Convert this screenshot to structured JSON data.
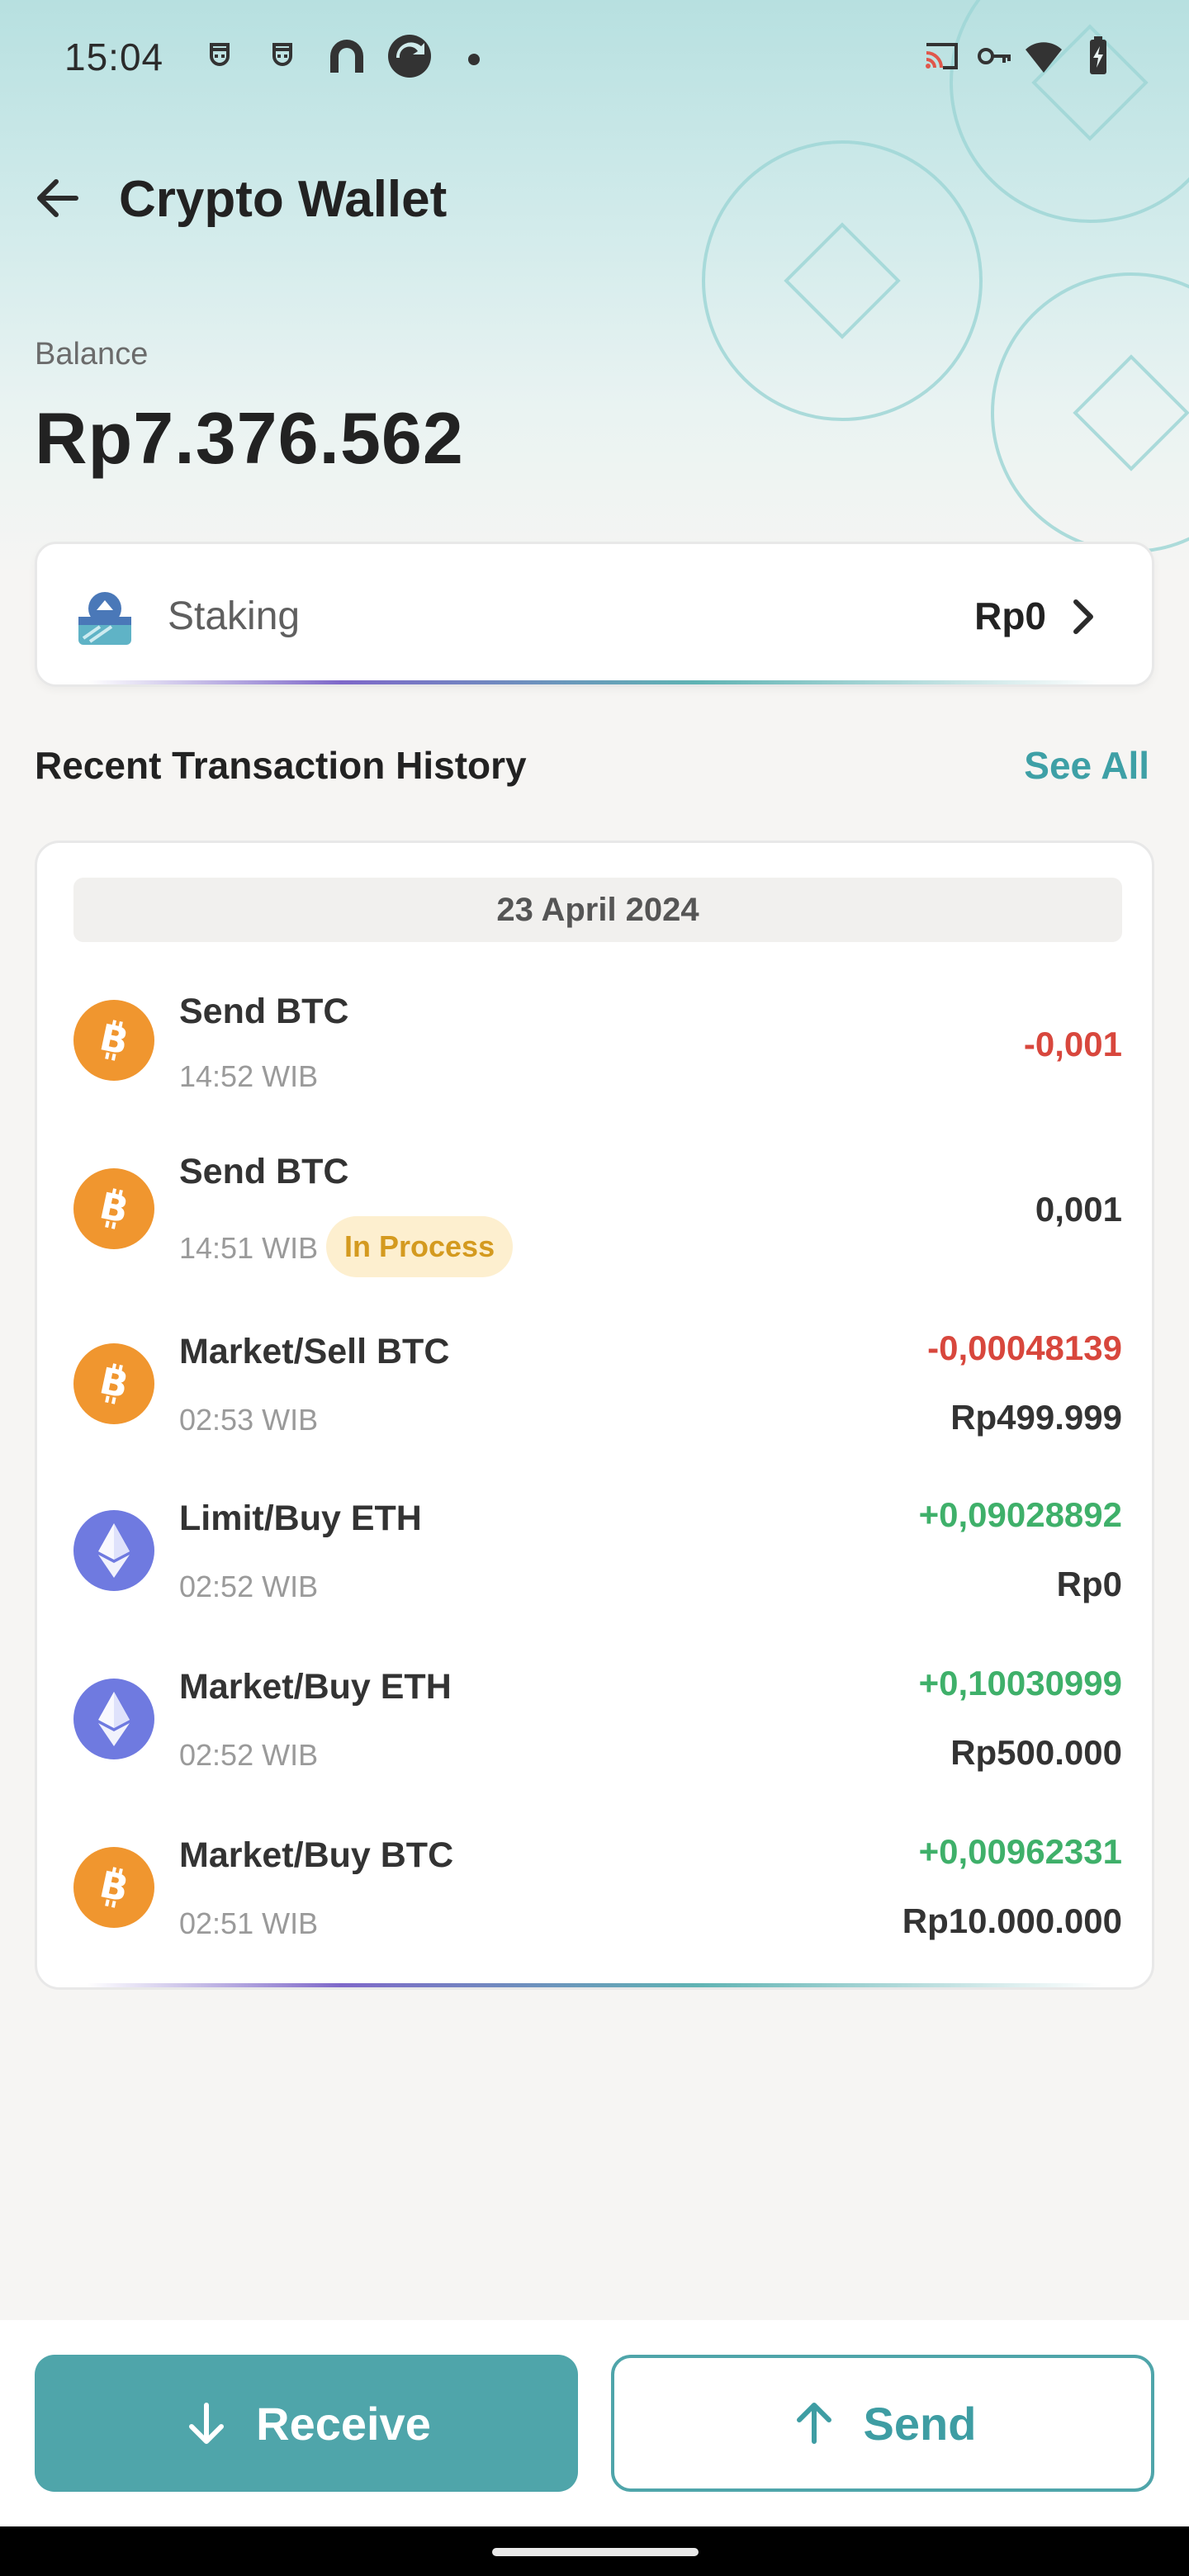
{
  "status_bar": {
    "time": "15:04",
    "left_icons": [
      "privacy-icon",
      "privacy-icon",
      "app-icon",
      "app-icon",
      "dot-icon"
    ],
    "right_icons": [
      "cast-icon",
      "vpn-key-icon",
      "wifi-icon",
      "battery-icon"
    ]
  },
  "app_bar": {
    "title": "Crypto Wallet",
    "back_icon": "arrow-left-icon"
  },
  "balance": {
    "label": "Balance",
    "value": "Rp7.376.562"
  },
  "staking": {
    "label": "Staking",
    "value": "Rp0",
    "icon": "staking-icon"
  },
  "history": {
    "title": "Recent Transaction History",
    "see_all": "See All",
    "date": "23 April 2024",
    "transactions": [
      {
        "coin": "BTC",
        "title": "Send BTC",
        "time": "14:52 WIB",
        "amount": "-0,001",
        "amount_color": "red",
        "fiat": ""
      },
      {
        "coin": "BTC",
        "title": "Send BTC",
        "time": "14:51 WIB",
        "status": "In Process",
        "amount": "0,001",
        "amount_color": "neutral",
        "fiat": ""
      },
      {
        "coin": "BTC",
        "title": "Market/Sell BTC",
        "time": "02:53 WIB",
        "amount": "-0,00048139",
        "amount_color": "red",
        "fiat": "Rp499.999"
      },
      {
        "coin": "ETH",
        "title": "Limit/Buy ETH",
        "time": "02:52 WIB",
        "amount": "+0,09028892",
        "amount_color": "green",
        "fiat": "Rp0"
      },
      {
        "coin": "ETH",
        "title": "Market/Buy ETH",
        "time": "02:52 WIB",
        "amount": "+0,10030999",
        "amount_color": "green",
        "fiat": "Rp500.000"
      },
      {
        "coin": "BTC",
        "title": "Market/Buy BTC",
        "time": "02:51 WIB",
        "amount": "+0,00962331",
        "amount_color": "green",
        "fiat": "Rp10.000.000"
      }
    ]
  },
  "actions": {
    "receive": "Receive",
    "send": "Send"
  },
  "colors": {
    "accent": "#4fa5aa",
    "negative": "#d8473d",
    "positive": "#3fb06a",
    "btc": "#f0962f",
    "eth": "#6f7ae0"
  }
}
